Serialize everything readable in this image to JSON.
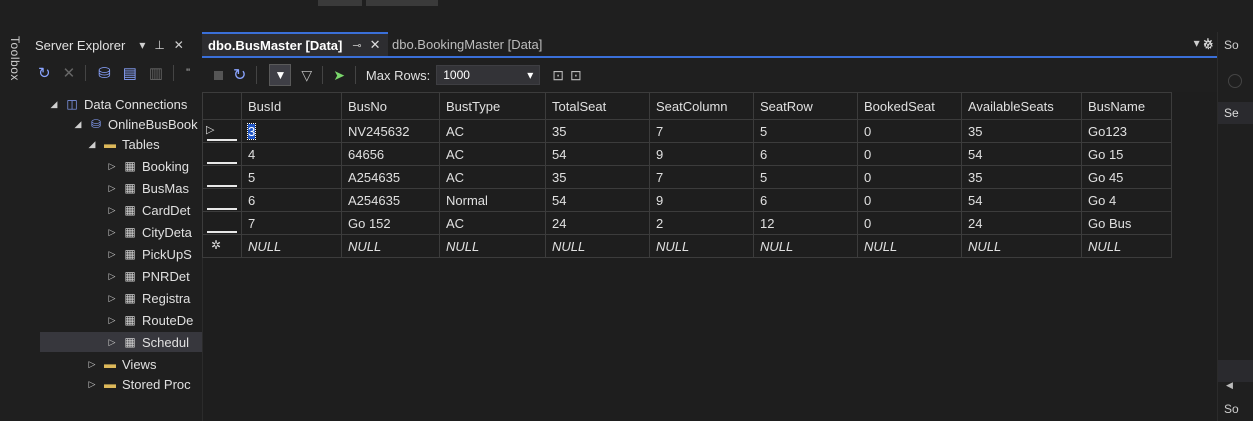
{
  "toolbox": {
    "label": "Toolbox"
  },
  "server_explorer": {
    "title": "Server Explorer",
    "header_buttons": {
      "dropdown": "▾",
      "pin": "⊥",
      "close": "✕"
    },
    "tree": [
      {
        "label": "Data Connections",
        "arrow": "◢",
        "icon": "◫"
      },
      {
        "label": "OnlineBusBook",
        "arrow": "◢",
        "icon": "⛁"
      },
      {
        "label": "Tables",
        "arrow": "◢",
        "icon": "▬"
      },
      {
        "label": "Booking",
        "arrow": "▷",
        "icon": "▦"
      },
      {
        "label": "BusMas",
        "arrow": "▷",
        "icon": "▦"
      },
      {
        "label": "CardDet",
        "arrow": "▷",
        "icon": "▦"
      },
      {
        "label": "CityDeta",
        "arrow": "▷",
        "icon": "▦"
      },
      {
        "label": "PickUpS",
        "arrow": "▷",
        "icon": "▦"
      },
      {
        "label": "PNRDet",
        "arrow": "▷",
        "icon": "▦"
      },
      {
        "label": "Registra",
        "arrow": "▷",
        "icon": "▦"
      },
      {
        "label": "RouteDe",
        "arrow": "▷",
        "icon": "▦"
      },
      {
        "label": "Schedul",
        "arrow": "▷",
        "icon": "▦"
      },
      {
        "label": "Views",
        "arrow": "▷",
        "icon": "▬"
      },
      {
        "label": "Stored Proc",
        "arrow": "▷",
        "icon": "▬"
      }
    ]
  },
  "tabs": [
    {
      "label": "dbo.BusMaster [Data]",
      "pin": "⊸",
      "close": "✕"
    },
    {
      "label": "dbo.BookingMaster [Data]"
    }
  ],
  "tabs_overflow": "▾ ✲",
  "data_toolbar": {
    "max_rows_label": "Max Rows:",
    "max_rows_value": "1000",
    "dropdown_arrow": "▾"
  },
  "grid": {
    "columns": [
      "BusId",
      "BusNo",
      "BustType",
      "TotalSeat",
      "SeatColumn",
      "SeatRow",
      "BookedSeat",
      "AvailableSeats",
      "BusName"
    ],
    "rows": [
      [
        "3",
        "NV245632",
        "AC",
        "35",
        "7",
        "5",
        "0",
        "35",
        "Go123"
      ],
      [
        "4",
        "64656",
        "AC",
        "54",
        "9",
        "6",
        "0",
        "54",
        "Go 15"
      ],
      [
        "5",
        "A254635",
        "AC",
        "35",
        "7",
        "5",
        "0",
        "35",
        "Go 45"
      ],
      [
        "6",
        "A254635",
        "Normal",
        "54",
        "9",
        "6",
        "0",
        "54",
        "Go 4"
      ],
      [
        "7",
        "Go 152",
        "AC",
        "24",
        "2",
        "12",
        "0",
        "24",
        "Go Bus"
      ]
    ],
    "new_row": [
      "NULL",
      "NULL",
      "NULL",
      "NULL",
      "NULL",
      "NULL",
      "NULL",
      "NULL",
      "NULL"
    ],
    "current_row_marker": "▷",
    "new_row_marker": "✲"
  },
  "right_panel": {
    "header": "So",
    "item": "Se",
    "footer": "So",
    "arrow": "◀"
  }
}
